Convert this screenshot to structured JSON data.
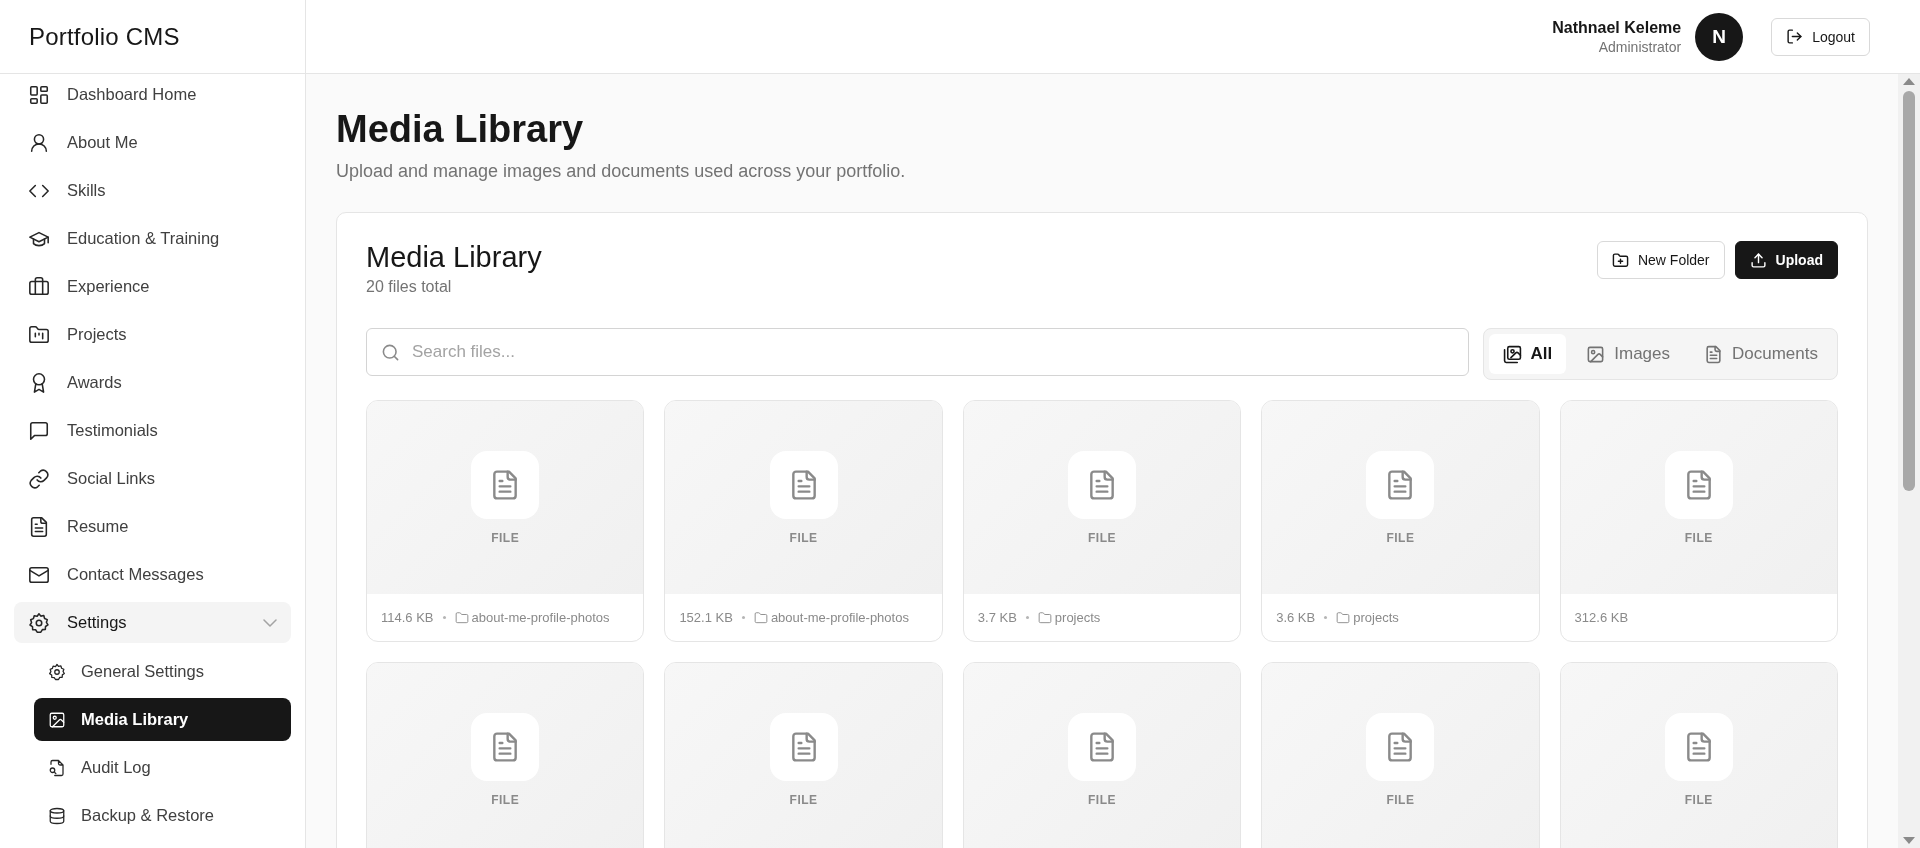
{
  "sidebar": {
    "brand": "Portfolio CMS",
    "items": [
      {
        "label": "Dashboard Home",
        "selected": false
      },
      {
        "label": "About Me",
        "selected": false
      },
      {
        "label": "Skills",
        "selected": false
      },
      {
        "label": "Education & Training",
        "selected": false
      },
      {
        "label": "Experience",
        "selected": false
      },
      {
        "label": "Projects",
        "selected": false
      },
      {
        "label": "Awards",
        "selected": false
      },
      {
        "label": "Testimonials",
        "selected": false
      },
      {
        "label": "Social Links",
        "selected": false
      },
      {
        "label": "Resume",
        "selected": false
      },
      {
        "label": "Contact Messages",
        "selected": false
      },
      {
        "label": "Settings",
        "selected": false,
        "expanded": true,
        "children": [
          {
            "label": "General Settings",
            "selected": false
          },
          {
            "label": "Media Library",
            "selected": true
          },
          {
            "label": "Audit Log",
            "selected": false
          },
          {
            "label": "Backup & Restore",
            "selected": false
          }
        ]
      }
    ]
  },
  "header": {
    "user_name": "Nathnael Keleme",
    "user_role": "Administrator",
    "avatar_initial": "N",
    "logout": "Logout"
  },
  "page": {
    "title": "Media Library",
    "subtitle": "Upload and manage images and documents used across your portfolio."
  },
  "library": {
    "title": "Media Library",
    "count": "20 files total",
    "buttons": [
      {
        "label": "New Folder",
        "kind": "secondary"
      },
      {
        "label": "Upload",
        "kind": "primary"
      }
    ],
    "search": {
      "placeholder": "Search files..."
    },
    "filters": [
      {
        "label": "All",
        "selected": true
      },
      {
        "label": "Images",
        "selected": false
      },
      {
        "label": "Documents",
        "selected": false
      }
    ],
    "files": [
      {
        "label": "FILE",
        "size": "114.6 KB",
        "folder": "about-me-profile-photos"
      },
      {
        "label": "FILE",
        "size": "152.1 KB",
        "folder": "about-me-profile-photos"
      },
      {
        "label": "FILE",
        "size": "3.7 KB",
        "folder": "projects"
      },
      {
        "label": "FILE",
        "size": "3.6 KB",
        "folder": "projects"
      },
      {
        "label": "FILE",
        "size": "312.6 KB"
      },
      {
        "label": "FILE"
      },
      {
        "label": "FILE"
      },
      {
        "label": "FILE"
      },
      {
        "label": "FILE"
      },
      {
        "label": "FILE"
      }
    ]
  }
}
